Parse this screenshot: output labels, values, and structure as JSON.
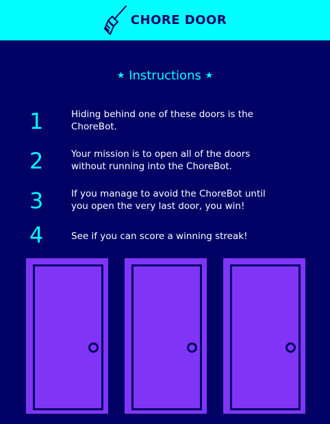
{
  "header": {
    "title": "CHORE DOOR",
    "logo_icon": "broom-icon",
    "background_color": "#00ffff",
    "text_color": "#010165"
  },
  "instructions": {
    "star_left": "★",
    "title": "Instructions",
    "star_right": "★",
    "steps": [
      {
        "number": "1",
        "text": "Hiding behind one of these doors is the ChoreBot."
      },
      {
        "number": "2",
        "text": "Your mission is to open all of the doors without running into the ChoreBot."
      },
      {
        "number": "3",
        "text": "If you manage to avoid the ChoreBot until you open the very last door, you win!"
      },
      {
        "number": "4",
        "text": "See if you can score a winning streak!"
      }
    ]
  },
  "doors": [
    {
      "state": "closed"
    },
    {
      "state": "closed"
    },
    {
      "state": "closed"
    }
  ],
  "colors": {
    "background": "#010165",
    "accent": "#00ffff",
    "door": "#8035f6"
  }
}
